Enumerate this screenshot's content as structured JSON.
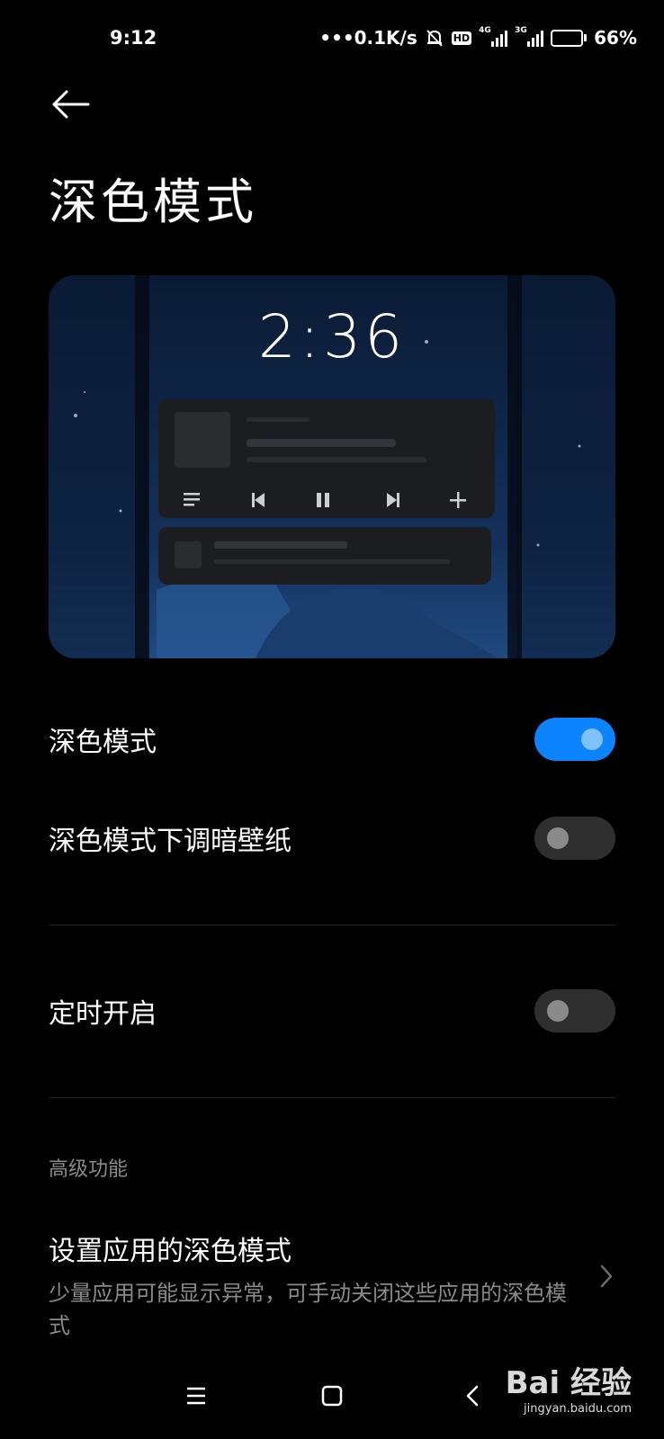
{
  "status_bar": {
    "time": "9:12",
    "speed": "•••0.1K/s",
    "network_1": "4G",
    "network_2": "3G",
    "hd": "HD",
    "battery": "66%"
  },
  "header": {
    "back_icon": "arrow-left-icon",
    "title": "深色模式"
  },
  "preview": {
    "clock": "2:36"
  },
  "settings": {
    "dark_mode": {
      "label": "深色模式",
      "enabled": true
    },
    "dim_wallpaper": {
      "label": "深色模式下调暗壁纸",
      "enabled": false
    },
    "scheduled": {
      "label": "定时开启",
      "enabled": false
    }
  },
  "advanced": {
    "section_label": "高级功能",
    "apps_title": "设置应用的深色模式",
    "apps_desc": "少量应用可能显示异常，可手动关闭这些应用的深色模式"
  },
  "nav": {
    "menu_icon": "menu-icon",
    "home_icon": "home-icon",
    "back_icon": "back-chevron-icon"
  },
  "watermark": {
    "brand": "Bai 经验",
    "url": "jingyan.baidu.com"
  },
  "colors": {
    "accent": "#0d84ff",
    "background": "#000000",
    "secondary_text": "#8a8a8a"
  }
}
